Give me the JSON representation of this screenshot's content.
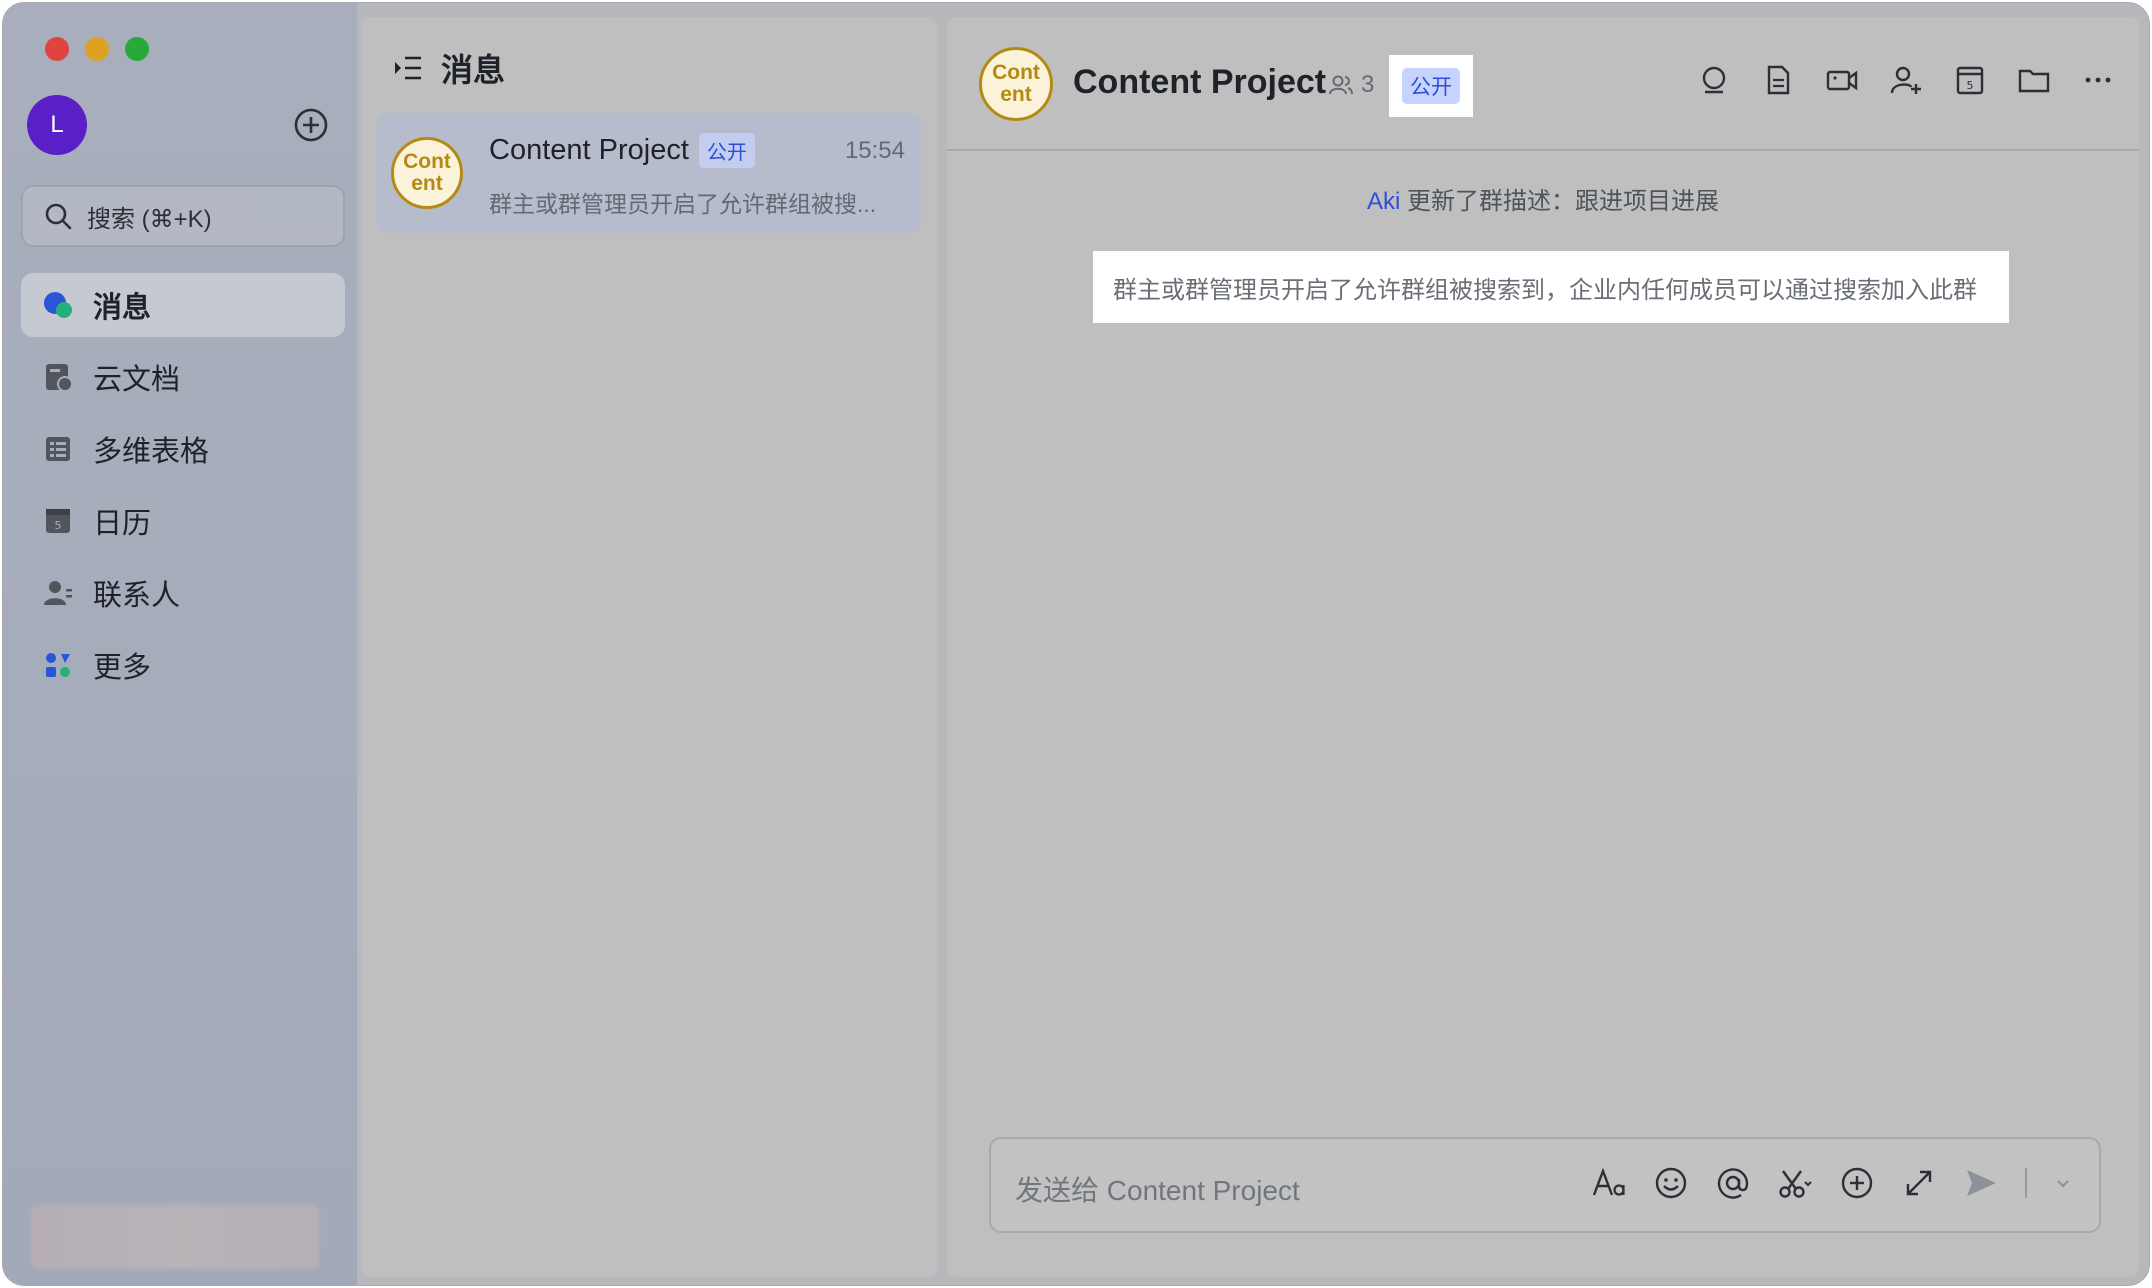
{
  "sidebar": {
    "avatar_letter": "L",
    "search_placeholder": "搜索 (⌘+K)",
    "nav": [
      {
        "label": "消息",
        "icon": "chat-bubbles-icon"
      },
      {
        "label": "云文档",
        "icon": "cloud-doc-icon"
      },
      {
        "label": "多维表格",
        "icon": "base-table-icon"
      },
      {
        "label": "日历",
        "icon": "calendar-icon"
      },
      {
        "label": "联系人",
        "icon": "contacts-icon"
      },
      {
        "label": "更多",
        "icon": "apps-icon"
      }
    ]
  },
  "list": {
    "header": "消息",
    "conversation": {
      "avatar_line1": "Cont",
      "avatar_line2": "ent",
      "title": "Content Project",
      "tag": "公开",
      "time": "15:54",
      "preview": "群主或群管理员开启了允许群组被搜..."
    }
  },
  "chat": {
    "avatar_line1": "Cont",
    "avatar_line2": "ent",
    "title": "Content Project",
    "member_count": "3",
    "tag": "公开",
    "system_actor": "Aki",
    "system_text": " 更新了群描述：跟进项目进展",
    "notice": "群主或群管理员开启了允许群组被搜索到，企业内任何成员可以通过搜索加入此群",
    "composer_placeholder": "发送给 Content Project"
  },
  "colors": {
    "accent_blue": "#2d4fd6",
    "avatar_purple": "#5a1fc7",
    "group_gold": "#b58a14"
  }
}
